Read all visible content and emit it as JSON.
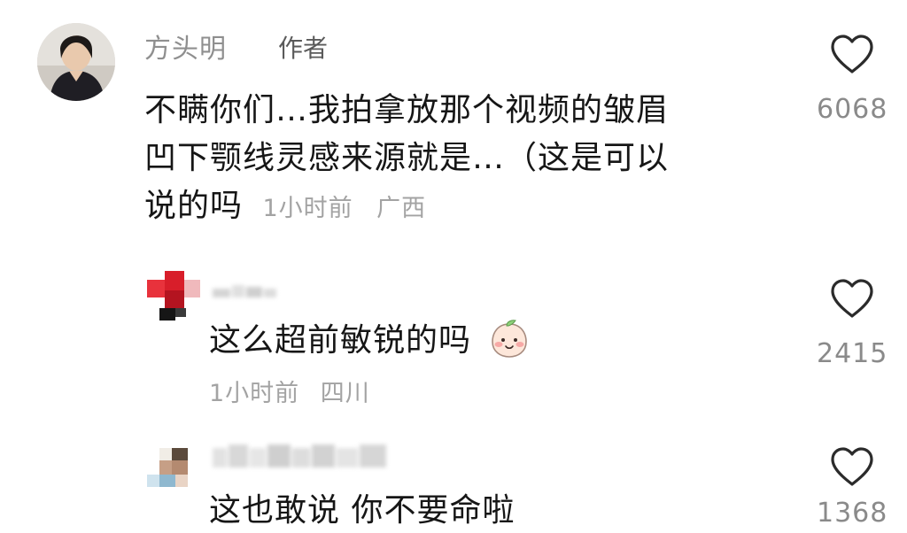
{
  "comments": [
    {
      "author": "方头明",
      "author_tag": "作者",
      "text_lines": [
        "不瞒你们…我拍拿放那个视频的皱眉",
        "凹下颚线灵感来源就是…（这是可以"
      ],
      "text_last": "说的吗",
      "time": "1小时前",
      "location": "广西",
      "likes": "6068",
      "avatar_icon": "user-photo-avatar"
    },
    {
      "author": "",
      "text": "这么超前敏锐的吗",
      "emoji": "peach-face-emoji",
      "time": "1小时前",
      "location": "四川",
      "likes": "2415",
      "avatar_icon": "pixelated-avatar"
    },
    {
      "author": "",
      "text": "这也敢说 你不要命啦",
      "likes": "1368",
      "avatar_icon": "pixelated-avatar"
    }
  ],
  "colors": {
    "name": "#8f8f8f",
    "text": "#161616",
    "meta": "#a3a3a3",
    "count": "#8a8a8a"
  }
}
